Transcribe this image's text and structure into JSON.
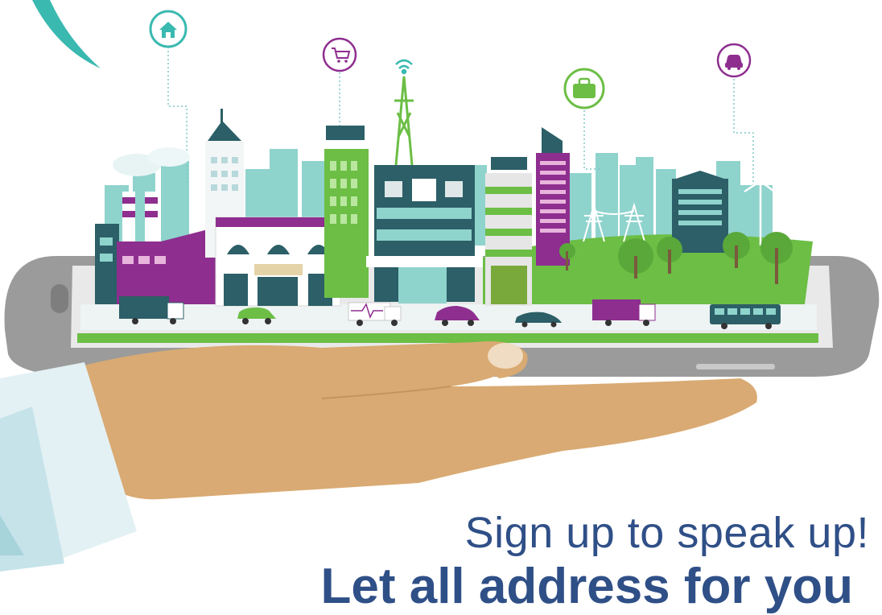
{
  "headline": "Sign up to speak up!",
  "subline": "Let all address for you",
  "icons": [
    "home-icon",
    "shopping-cart-icon",
    "wifi-icon",
    "briefcase-icon",
    "car-icon"
  ],
  "colors": {
    "teal": "#3ab9b0",
    "purple": "#8e2e8f",
    "green": "#6cbe45",
    "navy": "#2f4f87",
    "dark_teal": "#2c5f67",
    "tablet_gray": "#9b9b9b",
    "skin": "#d9aa73"
  }
}
